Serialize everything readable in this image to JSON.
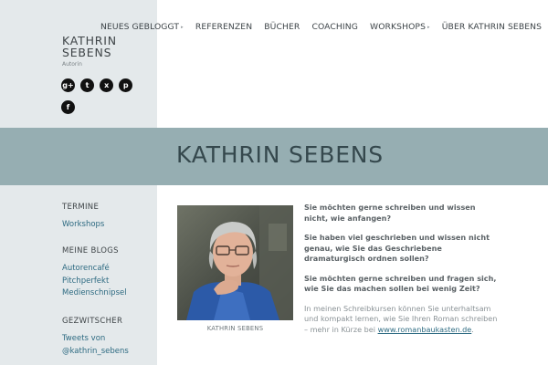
{
  "nav": {
    "items": [
      {
        "label": "NEUES GEBLOGGT",
        "caret": "▸"
      },
      {
        "label": "REFERENZEN"
      },
      {
        "label": "BÜCHER"
      },
      {
        "label": "COACHING"
      },
      {
        "label": "WORKSHOPS",
        "caret": "▸"
      },
      {
        "label": "ÜBER KATHRIN SEBENS"
      }
    ]
  },
  "brand": {
    "first_name": "KATHRIN",
    "last_name": "SEBENS",
    "subtitle": "Autorin"
  },
  "social": {
    "icons": [
      "googleplus-icon",
      "twitter-icon",
      "xing-icon",
      "pinterest-icon",
      "facebook-icon"
    ],
    "glyphs": [
      "g+",
      "t",
      "x",
      "p",
      "f"
    ]
  },
  "banner": {
    "title": "KATHRIN SEBENS",
    "color": "#96aeb2"
  },
  "sidebar": {
    "sections": [
      {
        "heading": "TERMINE",
        "links": [
          "Workshops"
        ]
      },
      {
        "heading": "MEINE BLOGS",
        "links": [
          "Autorencafé",
          "Pitchperfekt",
          "Medienschnipsel"
        ]
      },
      {
        "heading": "GEZWITSCHER",
        "links": [
          "Tweets von",
          "@kathrin_sebens"
        ]
      }
    ]
  },
  "photo": {
    "caption": "KATHRIN SEBENS"
  },
  "content": {
    "lead1": "Sie möchten gerne schreiben und wissen nicht, wie anfangen?",
    "lead2": "Sie haben viel geschrieben und wissen nicht genau, wie Sie das Geschriebene dramaturgisch ordnen sollen?",
    "lead3": "Sie möchten gerne schreiben und fragen sich, wie Sie das machen sollen bei wenig Zeit?",
    "body": "In meinen Schreibkursen können Sie unterhaltsam und kompakt lernen, wie Sie Ihren Roman schreiben – mehr in Kürze bei",
    "link": "www.romanbaukasten.de",
    "link_suffix": "."
  },
  "colors": {
    "link": "#2e6b82",
    "sidebar_bg": "#e4e9eb",
    "banner_bg": "#96aeb2"
  }
}
